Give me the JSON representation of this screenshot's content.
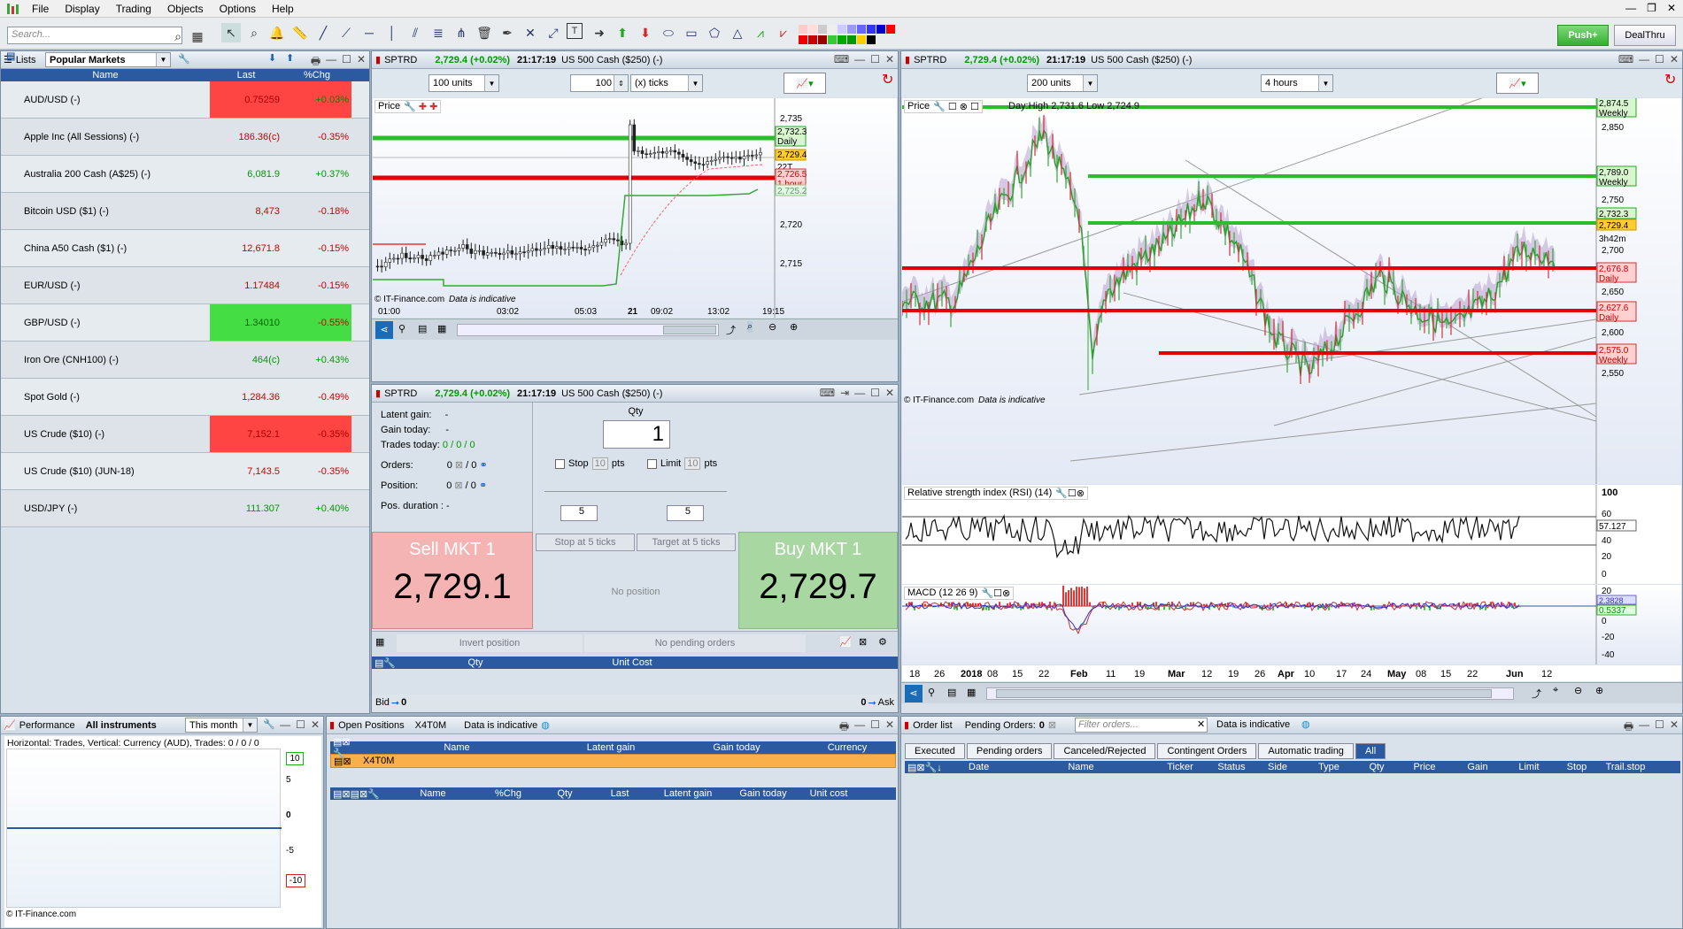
{
  "menu": [
    "File",
    "Display",
    "Trading",
    "Objects",
    "Options",
    "Help"
  ],
  "search": {
    "placeholder": "Search..."
  },
  "toolbar": {
    "push_label": "Push+",
    "dealthru_label": "DealThru"
  },
  "lists": {
    "title": "Lists",
    "selected_list": "Popular Markets",
    "columns": [
      "Name",
      "Last",
      "%Chg"
    ],
    "rows": [
      {
        "name": "AUD/USD (-)",
        "last": "0.75259",
        "chg": "+0.03%"
      },
      {
        "name": "Apple Inc (All Sessions) (-)",
        "last": "186.36(c)",
        "chg": "-0.35%"
      },
      {
        "name": "Australia 200 Cash (A$25) (-)",
        "last": "6,081.9",
        "chg": "+0.37%"
      },
      {
        "name": "Bitcoin USD ($1) (-)",
        "last": "8,473",
        "chg": "-0.18%"
      },
      {
        "name": "China A50 Cash ($1) (-)",
        "last": "12,671.8",
        "chg": "-0.15%"
      },
      {
        "name": "EUR/USD (-)",
        "last": "1.17484",
        "chg": "-0.15%"
      },
      {
        "name": "GBP/USD (-)",
        "last": "1.34010",
        "chg": "-0.55%"
      },
      {
        "name": "Iron Ore (CNH100) (-)",
        "last": "464(c)",
        "chg": "+0.43%"
      },
      {
        "name": "Spot Gold (-)",
        "last": "1,284.36",
        "chg": "-0.49%"
      },
      {
        "name": "US Crude ($10) (-)",
        "last": "7,152.1",
        "chg": "-0.35%"
      },
      {
        "name": "US Crude ($10) (JUN-18)",
        "last": "7,143.5",
        "chg": "-0.35%"
      },
      {
        "name": "USD/JPY (-)",
        "last": "111.307",
        "chg": "+0.40%"
      }
    ]
  },
  "chart1": {
    "ticker": "SPTRD",
    "price": "2,729.4 (+0.02%)",
    "time": "21:17:19",
    "instrument": "US 500 Cash ($250) (-)",
    "units": "100 units",
    "ticks_value": "100",
    "ticks_label": "(x) ticks",
    "label": "Price",
    "footer": "© IT-Finance.com",
    "indicative": "Data is indicative",
    "yticks": [
      "2,735",
      "2,732.3",
      "2,729.4",
      "2,726.5",
      "2,725.2",
      "2,720",
      "2,715"
    ],
    "xticks": [
      "01:00",
      "03:02",
      "05:03",
      "21",
      "09:02",
      "13:02",
      "19:15"
    ],
    "tag_daily": "Daily",
    "tag_1h": "1 hour",
    "tag_22t": "22T"
  },
  "ticket": {
    "ticker": "SPTRD",
    "price": "2,729.4 (+0.02%)",
    "time": "21:17:19",
    "instrument": "US 500 Cash ($250) (-)",
    "latent_gain": "Latent gain:",
    "latent_val": "-",
    "gain_today": "Gain today:",
    "gain_val": "-",
    "trades_today": "Trades today:",
    "trades_val": "0 / 0 / 0",
    "orders": "Orders:",
    "orders_val": "0",
    "orders_val2": "/ 0",
    "position": "Position:",
    "position_val": "0",
    "position_val2": "/ 0",
    "pos_duration": "Pos. duration :",
    "pos_duration_val": "-",
    "qty_label": "Qty",
    "qty": "1",
    "stop": "Stop",
    "stop_val": "10",
    "limit": "Limit",
    "limit_val": "10",
    "pts": "pts",
    "step1": "5",
    "step2": "5",
    "sell_label": "Sell MKT 1",
    "sell_price": "2,729.1",
    "buy_label": "Buy MKT 1",
    "buy_price": "2,729.7",
    "stop_at": "Stop at 5 ticks",
    "target_at": "Target at 5 ticks",
    "no_position": "No position",
    "invert": "Invert position",
    "no_pending": "No pending orders",
    "col_qty": "Qty",
    "col_unit": "Unit Cost",
    "bid": "Bid",
    "bid_val": "0",
    "ask": "Ask",
    "ask_val": "0"
  },
  "chart2": {
    "ticker": "SPTRD",
    "price": "2,729.4 (+0.02%)",
    "time": "21:17:19",
    "instrument": "US 500 Cash ($250) (-)",
    "units": "200 units",
    "period": "4 hours",
    "label": "Price",
    "dayinfo": "Day:High 2,731.6 Low 2,724.9",
    "footer": "© IT-Finance.com",
    "indicative": "Data is indicative",
    "yticks": [
      "2,874.5",
      "2,850",
      "2,789.0",
      "2,750",
      "2,732.3",
      "2,729.4",
      "3h42m",
      "2,700",
      "2,676.8",
      "2,650",
      "2,627.6",
      "2,600",
      "2,575.0",
      "2,550"
    ],
    "weekly": "Weekly",
    "daily": "Daily",
    "rsi_label": "Relative strength index (RSI) (14)",
    "rsi_ticks": [
      "100",
      "57.127",
      "40",
      "20",
      "0"
    ],
    "rsi_top": "60",
    "macd_label": "MACD (12 26 9)",
    "macd_ticks": [
      "20",
      "0",
      "-20",
      "-40"
    ],
    "macd_v1": "2.3828",
    "macd_v2": "0.5337",
    "xticks": [
      "18",
      "26",
      "2018",
      "08",
      "15",
      "22",
      "Feb",
      "11",
      "19",
      "Mar",
      "12",
      "19",
      "26",
      "Apr",
      "10",
      "17",
      "24",
      "May",
      "08",
      "15",
      "22",
      "Jun",
      "12"
    ]
  },
  "performance": {
    "title": "Performance",
    "filter": "All instruments",
    "period": "This month",
    "caption": "Horizontal: Trades, Vertical: Currency (AUD), Trades: 0 / 0 / 0",
    "yticks": [
      "10",
      "5",
      "0",
      "-5",
      "-10"
    ],
    "footer": "© IT-Finance.com"
  },
  "positions": {
    "title": "Open Positions",
    "account": "X4T0M",
    "indicative": "Data is indicative",
    "cols1": [
      "Name",
      "Latent gain",
      "Gain today",
      "Currency"
    ],
    "row": "X4T0M",
    "cols2": [
      "Name",
      "%Chg",
      "Qty",
      "Last",
      "Latent gain",
      "Gain today",
      "Unit cost"
    ]
  },
  "orders": {
    "title": "Order list",
    "pending": "Pending Orders:",
    "pending_val": "0",
    "filter_placeholder": "Filter orders...",
    "indicative": "Data is indicative",
    "tabs": [
      "Executed",
      "Pending orders",
      "Canceled/Rejected",
      "Contingent Orders",
      "Automatic trading",
      "All"
    ],
    "cols": [
      "Date",
      "Name",
      "Ticker",
      "Status",
      "Side",
      "Type",
      "Qty",
      "Price",
      "Gain",
      "Limit",
      "Stop",
      "Trail.stop"
    ]
  },
  "colors": {
    "accent": "#2b5aa0",
    "green_line": "#2cbd2c",
    "red_line": "#e30000",
    "sell_bg": "#f4b4b4",
    "buy_bg": "#a9d7a1"
  }
}
